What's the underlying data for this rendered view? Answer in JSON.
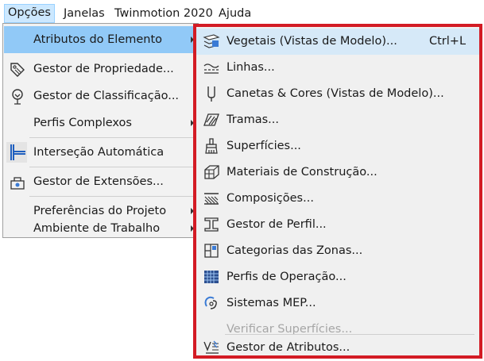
{
  "menubar": {
    "items": [
      {
        "label": "Opções"
      },
      {
        "label": "Janelas"
      },
      {
        "label": "Twinmotion 2020"
      },
      {
        "label": "Ajuda"
      }
    ]
  },
  "left_menu": {
    "items": [
      {
        "label": "Atributos do Elemento",
        "has_submenu": true,
        "highlighted": true
      },
      {
        "label": "Gestor de Propriedade...",
        "icon": "tag-icon"
      },
      {
        "label": "Gestor de Classificação...",
        "icon": "classification-tree-icon"
      },
      {
        "label": "Perfis Complexos",
        "has_submenu": true
      },
      {
        "label": "Interseção Automática",
        "icon": "intersection-icon"
      },
      {
        "label": "Gestor de Extensões...",
        "icon": "extensions-icon"
      },
      {
        "label": "Preferências do Projeto",
        "has_submenu": true
      },
      {
        "label": "Ambiente de Trabalho",
        "has_submenu": true
      }
    ]
  },
  "submenu": {
    "items": [
      {
        "label": "Vegetais (Vistas de Modelo)...",
        "shortcut": "Ctrl+L",
        "icon": "layers-icon"
      },
      {
        "label": "Linhas...",
        "icon": "line-types-icon"
      },
      {
        "label": "Canetas & Cores (Vistas de Modelo)...",
        "icon": "pen-icon"
      },
      {
        "label": "Tramas...",
        "icon": "hatch-icon"
      },
      {
        "label": "Superfícies...",
        "icon": "paint-brush-icon"
      },
      {
        "label": "Materiais de Construção...",
        "icon": "building-material-icon"
      },
      {
        "label": "Composições...",
        "icon": "composites-icon"
      },
      {
        "label": "Gestor de Perfil...",
        "icon": "profile-icon"
      },
      {
        "label": "Categorias das Zonas...",
        "icon": "zone-categories-icon"
      },
      {
        "label": "Perfis de Operação...",
        "icon": "operation-profiles-icon"
      },
      {
        "label": "Sistemas MEP...",
        "icon": "mep-systems-icon"
      },
      {
        "label": "Verificar Superfícies...",
        "disabled": true
      },
      {
        "label": "Gestor de Atributos...",
        "icon": "attribute-manager-icon"
      }
    ]
  }
}
